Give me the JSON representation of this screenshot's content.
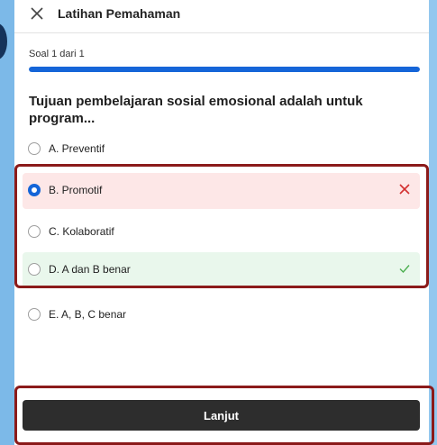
{
  "header": {
    "title": "Latihan Pemahaman",
    "close_icon": "close-icon"
  },
  "progress": {
    "label": "Soal 1 dari 1",
    "fraction": 1.0,
    "color": "#1565d8"
  },
  "question": {
    "text": "Tujuan pembelajaran sosial emosional adalah untuk program..."
  },
  "options": [
    {
      "label": "A. Preventif",
      "state": "default"
    },
    {
      "label": "B. Promotif",
      "state": "selected-wrong",
      "mark_icon": "cross-icon",
      "mark_color": "#d32f2f"
    },
    {
      "label": "C. Kolaboratif",
      "state": "default"
    },
    {
      "label": "D. A dan B benar",
      "state": "correct",
      "mark_icon": "check-icon",
      "mark_color": "#4caf50"
    },
    {
      "label": "E. A, B, C benar",
      "state": "default"
    }
  ],
  "footer": {
    "next_label": "Lanjut"
  },
  "colors": {
    "accent": "#1565d8",
    "wrong_bg": "#fde7e7",
    "correct_bg": "#e9f7ec",
    "highlight_border": "#8b1a1a",
    "button_bg": "#2d2d2d"
  }
}
